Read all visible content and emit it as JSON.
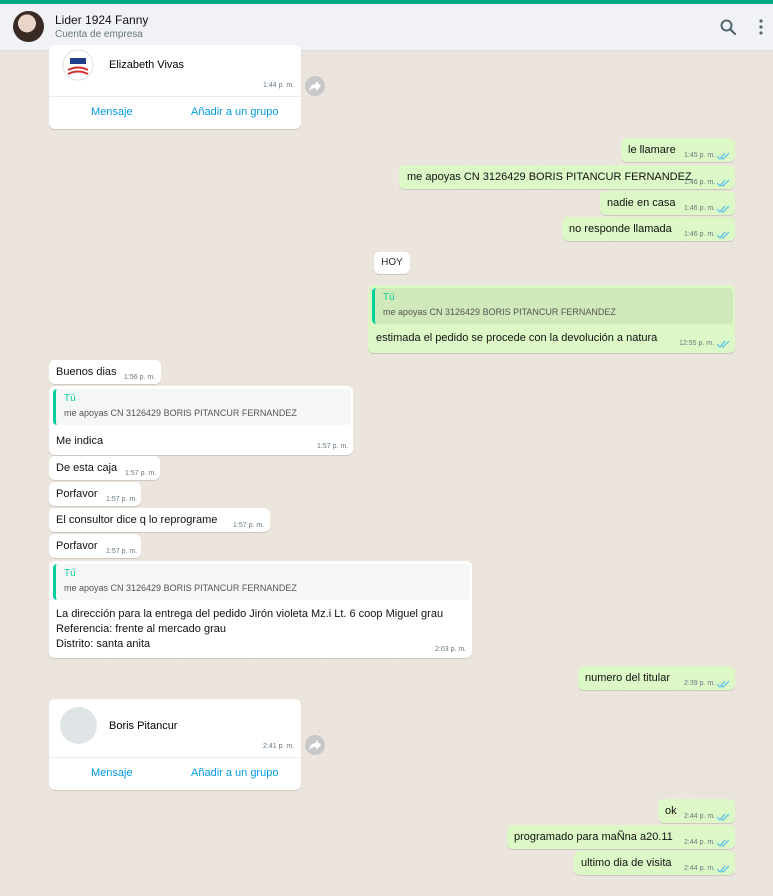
{
  "header": {
    "contact_name": "Lider 1924 Fanny",
    "contact_subtitle": "Cuenta de empresa",
    "search_icon": "search-icon",
    "menu_icon": "menu-dots-icon"
  },
  "colors": {
    "accent": "#00a884",
    "incoming": "#ffffff",
    "outgoing": "#dcf8c6",
    "link": "#039be5",
    "ticks": "#53bdeb"
  },
  "contact_card_1": {
    "name": "Elizabeth Vivas",
    "time": "1:44 p. m.",
    "btn_message": "Mensaje",
    "btn_add": "Añadir a un grupo"
  },
  "messages_1": [
    {
      "text": "le llamare",
      "time": "1:45 p. m."
    },
    {
      "text": "me apoyas CN 3126429 BORIS PITANCUR FERNANDEZ",
      "time": "1:46 p. m."
    },
    {
      "text": "nadie en casa",
      "time": "1:46 p. m."
    },
    {
      "text": "no responde llamada",
      "time": "1:46 p. m."
    }
  ],
  "day_label": "HOY",
  "reply_out": {
    "quote_author": "Tú",
    "quote_text": "me apoyas CN 3126429 BORIS PITANCUR FERNANDEZ",
    "text": "estimada el pedido se procede con la devolución a natura",
    "time": "12:55 p. m."
  },
  "msg_buenos": {
    "text": "Buenos dias",
    "time": "1:56 p. m."
  },
  "reply_in_1": {
    "quote_author": "Tú",
    "quote_text": "me apoyas CN 3126429 BORIS PITANCUR FERNANDEZ",
    "text": "Me indica",
    "time": "1:57 p. m."
  },
  "messages_in": [
    {
      "text": "De esta caja",
      "time": "1:57 p. m."
    },
    {
      "text": "Porfavor",
      "time": "1:57 p. m."
    },
    {
      "text": "El consultor dice q lo reprograme",
      "time": "1:57 p. m."
    },
    {
      "text": "Porfavor",
      "time": "1:57 p. m."
    }
  ],
  "reply_in_2": {
    "quote_author": "Tú",
    "quote_text": "me apoyas CN 3126429 BORIS PITANCUR FERNANDEZ",
    "line1": "La dirección para la entrega del pedido Jirón violeta Mz.i Lt. 6 coop Miguel grau",
    "line2": "Referencia: frente al mercado grau",
    "line3": "Distrito: santa anita",
    "time": "2:03 p. m."
  },
  "msg_titular": {
    "text": "numero del titular",
    "time": "2:39 p. m."
  },
  "contact_card_2": {
    "name": "Boris Pitancur",
    "time": "2:41 p. m.",
    "btn_message": "Mensaje",
    "btn_add": "Añadir a un grupo"
  },
  "messages_2": [
    {
      "text": "ok",
      "time": "2:44 p. m."
    },
    {
      "text": "programado para maÑna a20.11",
      "time": "2:44 p. m."
    },
    {
      "text": "ultimo dia de visita",
      "time": "2:44 p. m."
    }
  ]
}
